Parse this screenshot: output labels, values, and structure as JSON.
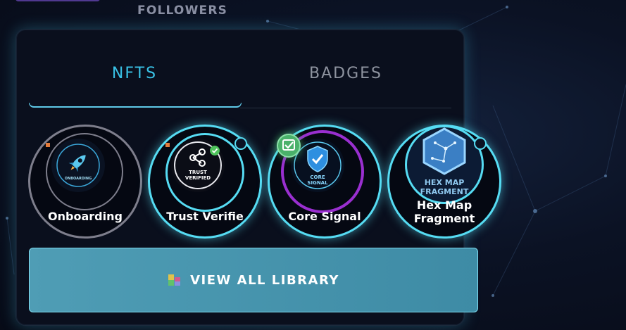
{
  "header": {
    "followers_label": "FOLLOWERS"
  },
  "tabs": [
    {
      "label": "NFTS",
      "active": true
    },
    {
      "label": "BADGES",
      "active": false
    }
  ],
  "nfts": [
    {
      "name": "Onboarding",
      "badge_text": "ONBOARDING",
      "icon": "rocket-icon",
      "state": "inactive"
    },
    {
      "name": "Trust Verifie",
      "badge_text_line1": "TRUST",
      "badge_text_line2": "VERIFIED",
      "icon": "share-icon",
      "state": "active",
      "verified": true
    },
    {
      "name": "Core Signal",
      "badge_text_line1": "CORE",
      "badge_text_line2": "SIGNAL",
      "icon": "shield-check-icon",
      "state": "active",
      "checked": true
    },
    {
      "name_line1": "Hex Map",
      "name_line2": "Fragment",
      "badge_text_line1": "HEX MAP",
      "badge_text_line2": "FRAGMENT",
      "icon": "hex-map-icon",
      "state": "active"
    }
  ],
  "actions": {
    "view_all_label": "VIEW ALL LIBRARY"
  },
  "colors": {
    "accent": "#39c2e6",
    "ring_active": "#56dcf3",
    "ring_purple": "#9a2fd0",
    "button_bg": "#4f9db5"
  }
}
